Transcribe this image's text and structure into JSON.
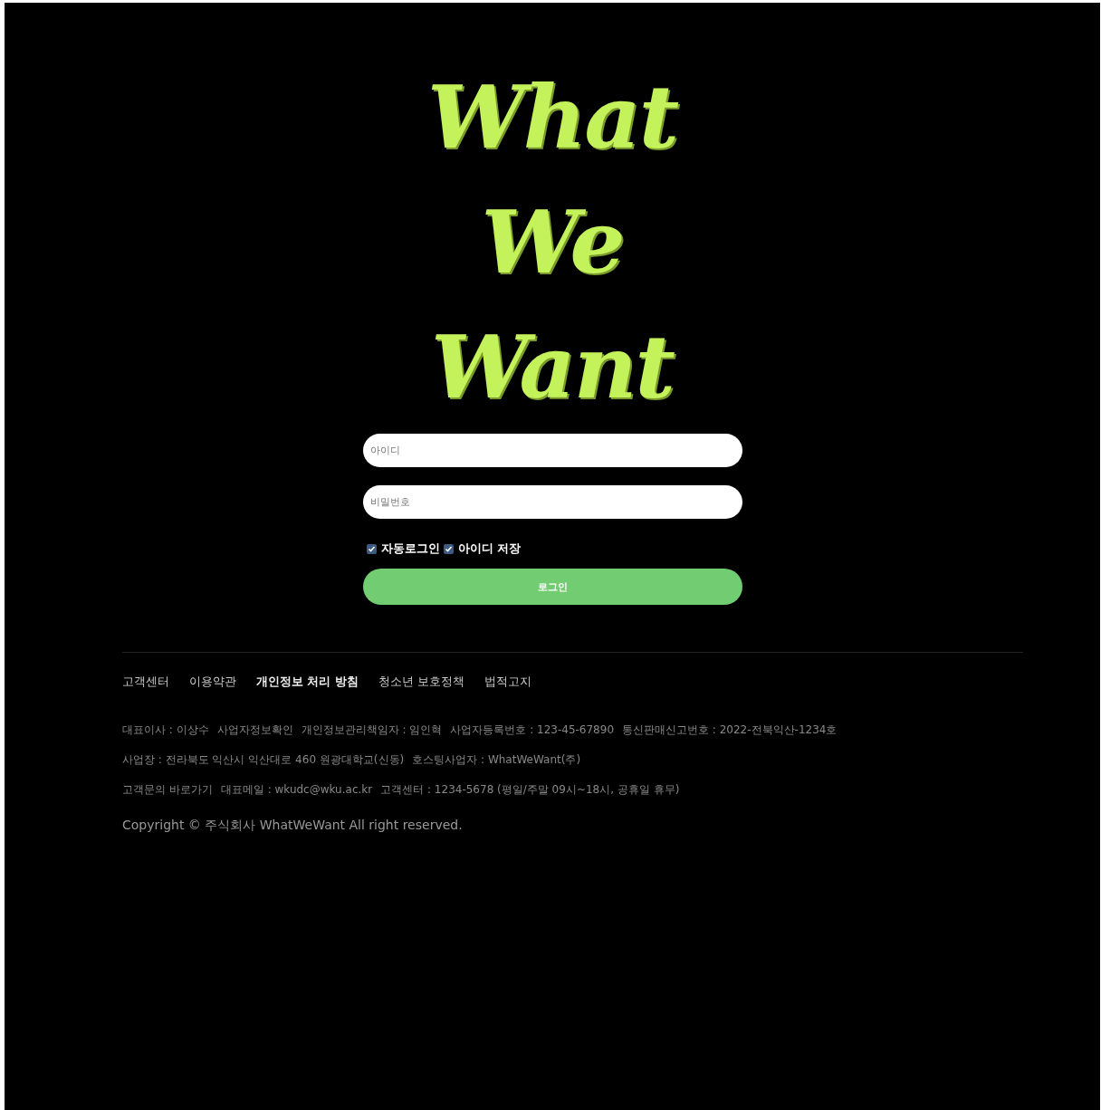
{
  "logo": {
    "lines": [
      "What",
      "We",
      "Want"
    ]
  },
  "login": {
    "fields": [
      {
        "placeholder": "아이디"
      },
      {
        "placeholder": "비밀번호"
      }
    ],
    "options": [
      {
        "label": "자동로그인",
        "checked": true
      },
      {
        "label": "아이디 저장",
        "checked": true
      }
    ],
    "button": "로그인"
  },
  "footer": {
    "links": [
      {
        "label": "고객센터",
        "emphasized": false
      },
      {
        "label": "이용약관",
        "emphasized": false
      },
      {
        "label": "개인정보 처리 방침",
        "emphasized": true
      },
      {
        "label": "청소년 보호정책",
        "emphasized": false
      },
      {
        "label": "법적고지",
        "emphasized": false
      }
    ],
    "info_lines": [
      [
        "대표이사 : 이상수",
        "사업자정보확인",
        "개인정보관리책임자 : 임인혁",
        "사업자등록번호 : 123-45-67890",
        "통신판매신고번호 : 2022-전북익산-1234호"
      ],
      [
        "사업장 : 전라북도 익산시 익산대로 460 원광대학교(신동)",
        "호스팅사업자 : WhatWeWant(주)"
      ],
      [
        "고객문의 바로가기",
        "대표메일 : wkudc@wku.ac.kr",
        "고객센터 : 1234-5678 (평일/주말 09시~18시, 공휴일 휴무)"
      ]
    ],
    "copyright": "Copyright © 주식회사 WhatWeWant All right reserved."
  }
}
